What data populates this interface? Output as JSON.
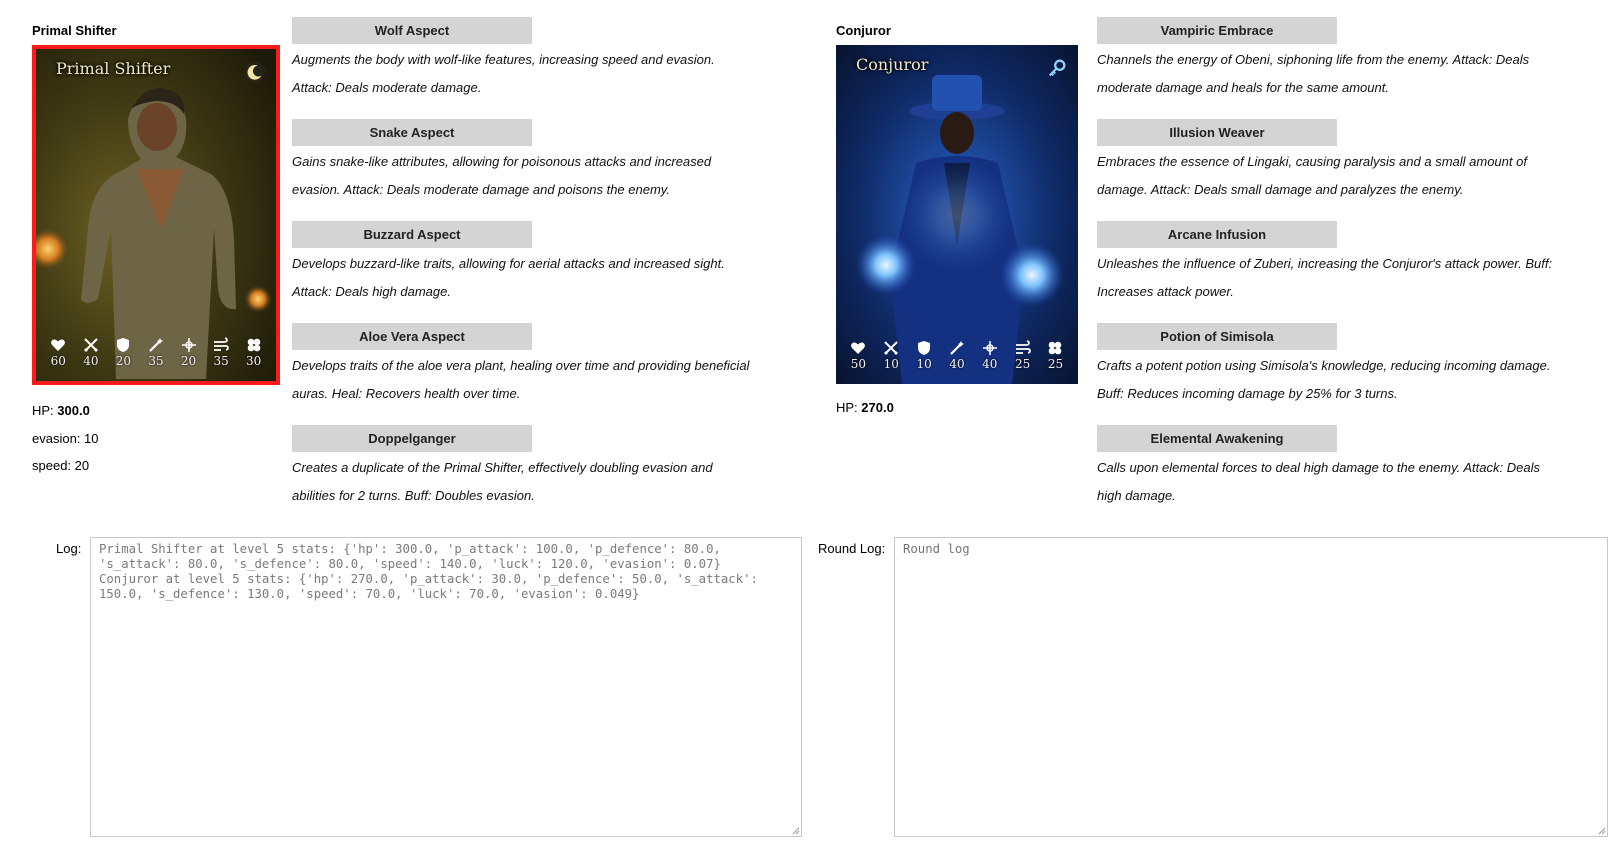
{
  "players": [
    {
      "name": "Primal Shifter",
      "card_title": "Primal Shifter",
      "badge_icon": "moon-icon",
      "stats": [
        {
          "icon": "heart-icon",
          "value": "60"
        },
        {
          "icon": "swords-icon",
          "value": "40"
        },
        {
          "icon": "shield-icon",
          "value": "20"
        },
        {
          "icon": "wand-icon",
          "value": "35"
        },
        {
          "icon": "magic-shield-icon",
          "value": "20"
        },
        {
          "icon": "wind-icon",
          "value": "35"
        },
        {
          "icon": "clover-icon",
          "value": "30"
        }
      ],
      "hp_label": "HP:",
      "hp_value": "300.0",
      "extra": [
        "evasion: 10",
        "speed: 20"
      ],
      "abilities": [
        {
          "name": "Wolf Aspect",
          "desc": "Augments the body with wolf-like features, increasing speed and evasion. Attack: Deals moderate damage."
        },
        {
          "name": "Snake Aspect",
          "desc": "Gains snake-like attributes, allowing for poisonous attacks and increased evasion. Attack: Deals moderate damage and poisons the enemy."
        },
        {
          "name": "Buzzard Aspect",
          "desc": "Develops buzzard-like traits, allowing for aerial attacks and increased sight. Attack: Deals high damage."
        },
        {
          "name": "Aloe Vera Aspect",
          "desc": "Develops traits of the aloe vera plant, healing over time and providing beneficial auras. Heal: Recovers health over time."
        },
        {
          "name": "Doppelganger",
          "desc": "Creates a duplicate of the Primal Shifter, effectively doubling evasion and abilities for 2 turns. Buff: Doubles evasion."
        }
      ]
    },
    {
      "name": "Conjuror",
      "card_title": "Conjuror",
      "badge_icon": "key-icon",
      "stats": [
        {
          "icon": "heart-icon",
          "value": "50"
        },
        {
          "icon": "swords-icon",
          "value": "10"
        },
        {
          "icon": "shield-icon",
          "value": "10"
        },
        {
          "icon": "wand-icon",
          "value": "40"
        },
        {
          "icon": "magic-shield-icon",
          "value": "40"
        },
        {
          "icon": "wind-icon",
          "value": "25"
        },
        {
          "icon": "clover-icon",
          "value": "25"
        }
      ],
      "hp_label": "HP:",
      "hp_value": "270.0",
      "extra": [],
      "abilities": [
        {
          "name": "Vampiric Embrace",
          "desc": "Channels the energy of Obeni, siphoning life from the enemy. Attack: Deals moderate damage and heals for the same amount."
        },
        {
          "name": "Illusion Weaver",
          "desc": "Embraces the essence of Lingaki, causing paralysis and a small amount of damage. Attack: Deals small damage and paralyzes the enemy."
        },
        {
          "name": "Arcane Infusion",
          "desc": "Unleashes the influence of Zuberi, increasing the Conjuror's attack power. Buff: Increases attack power."
        },
        {
          "name": "Potion of Simisola",
          "desc": "Crafts a potent potion using Simisola's knowledge, reducing incoming damage. Buff: Reduces incoming damage by 25% for 3 turns."
        },
        {
          "name": "Elemental Awakening",
          "desc": "Calls upon elemental forces to deal high damage to the enemy. Attack: Deals high damage."
        }
      ]
    }
  ],
  "log": {
    "label": "Log:",
    "text": "Primal Shifter at level 5 stats: {'hp': 300.0, 'p_attack': 100.0, 'p_defence': 80.0, 's_attack': 80.0, 's_defence': 80.0, 'speed': 140.0, 'luck': 120.0, 'evasion': 0.07}\nConjuror at level 5 stats: {'hp': 270.0, 'p_attack': 30.0, 'p_defence': 50.0, 's_attack': 150.0, 's_defence': 130.0, 'speed': 70.0, 'luck': 70.0, 'evasion': 0.049}"
  },
  "round_log": {
    "label": "Round Log:",
    "placeholder": "Round log",
    "value": ""
  },
  "colors": {
    "selected_border": "#ff1a1a",
    "button_bg": "#d4d4d4",
    "shifter_art_bg": "#3f3a14",
    "conjuror_art_bg": "#0f2a66"
  }
}
